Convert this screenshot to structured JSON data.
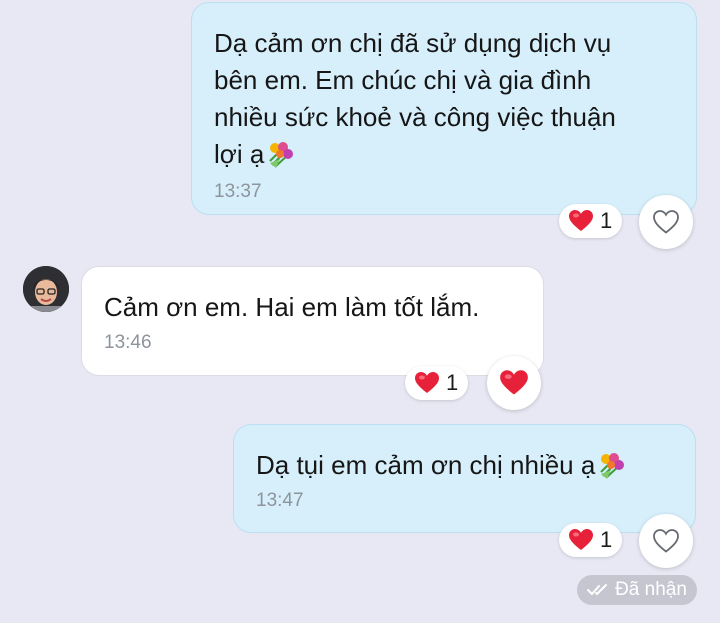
{
  "messages": [
    {
      "sender": "me",
      "text": "Dạ cảm ơn chị đã sử dụng dịch vụ\nbên em. Em chúc chị và gia đình\nnhiều sức khoẻ và công việc thuận\nlợi ạ",
      "emoji": "flowers-icon",
      "time": "13:37",
      "reaction_count": "1"
    },
    {
      "sender": "other",
      "text": "Cảm ơn em. Hai em làm tốt lắm.",
      "time": "13:46",
      "reaction_count": "1"
    },
    {
      "sender": "me",
      "text": "Dạ tụi em cảm ơn chị nhiều ạ",
      "emoji": "flowers-icon",
      "time": "13:47",
      "reaction_count": "1"
    }
  ],
  "status": {
    "label": "Đã nhận"
  },
  "colors": {
    "background": "#e7e8f3",
    "my_bubble": "#d6effb",
    "their_bubble": "#ffffff",
    "heart": "#e8213a",
    "time_text": "#8e949c"
  }
}
